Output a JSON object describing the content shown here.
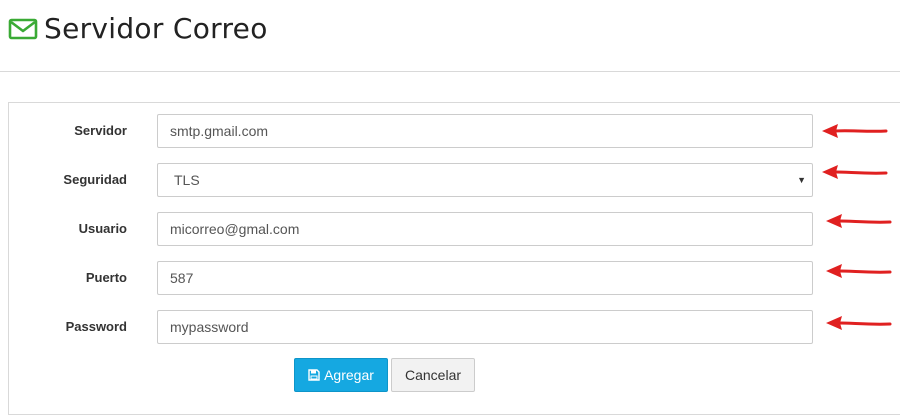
{
  "header": {
    "title": "Servidor Correo",
    "icon": "envelope-icon",
    "icon_color": "#3aaa35"
  },
  "form": {
    "fields": [
      {
        "label": "Servidor",
        "value": "smtp.gmail.com"
      },
      {
        "label": "Seguridad",
        "value": "TLS",
        "type": "select"
      },
      {
        "label": "Usuario",
        "value": "micorreo@gmal.com"
      },
      {
        "label": "Puerto",
        "value": "587"
      },
      {
        "label": "Password",
        "value": "mypassword"
      }
    ],
    "buttons": {
      "save_label": "Agregar",
      "cancel_label": "Cancelar",
      "save_icon": "floppy-disk-icon"
    }
  },
  "annotations": {
    "arrow_color": "#e02020",
    "arrow_icon": "red-arrow-icon"
  },
  "colors": {
    "primary_button": "#15a8e1",
    "border": "#cccccc"
  }
}
